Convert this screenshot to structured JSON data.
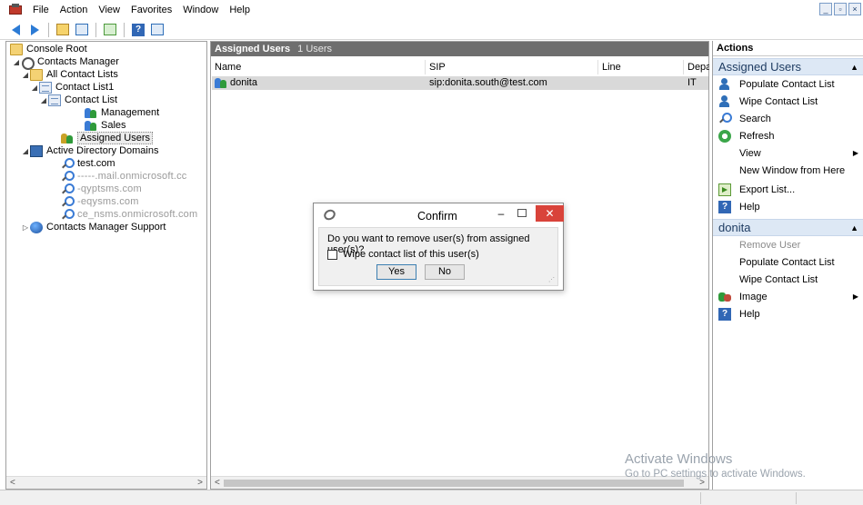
{
  "menubar": {
    "items": [
      "File",
      "Action",
      "View",
      "Favorites",
      "Window",
      "Help"
    ]
  },
  "tree": {
    "items": [
      {
        "label": "Console Root"
      },
      {
        "label": "Contacts Manager"
      },
      {
        "label": "All Contact Lists"
      },
      {
        "label": "Contact List1"
      },
      {
        "label": "Contact List"
      },
      {
        "label": "Management"
      },
      {
        "label": "Sales"
      },
      {
        "label": "Assigned Users"
      },
      {
        "label": "Active Directory Domains"
      },
      {
        "label": "test.com"
      },
      {
        "label": "-----.mail.onmicrosoft.cc"
      },
      {
        "label": "-qyptsms.com"
      },
      {
        "label": "-eqysms.com"
      },
      {
        "label": "ce_nsms.onmicrosoft.com"
      },
      {
        "label": "Contacts Manager Support"
      }
    ]
  },
  "center": {
    "header_title": "Assigned Users",
    "header_count": "1 Users",
    "columns": [
      "Name",
      "SIP",
      "Line",
      "Depa"
    ],
    "rows": [
      {
        "name": "donita",
        "sip": "sip:donita.south@test.com",
        "line": "",
        "dept": "IT"
      }
    ]
  },
  "actions": {
    "title": "Actions",
    "section1": {
      "label": "Assigned Users",
      "items": [
        "Populate Contact List",
        "Wipe Contact List",
        "Search",
        "Refresh",
        "View",
        "New Window from Here",
        "Export List...",
        "Help"
      ]
    },
    "section2": {
      "label": "donita",
      "items": [
        "Remove User",
        "Populate Contact List",
        "Wipe Contact List",
        "Image",
        "Help"
      ]
    }
  },
  "dialog": {
    "title": "Confirm",
    "question": "Do you want to remove user(s) from assigned user(s)?",
    "checkbox_label": "Wipe contact list of this user(s)",
    "checkbox_checked": false,
    "yes_label": "Yes",
    "no_label": "No",
    "close_symbol": "✕",
    "min_symbol": "–"
  },
  "watermark": {
    "line1": "Activate Windows",
    "line2": "Go to PC settings to activate Windows."
  },
  "scroll": {
    "left_arrow": "<",
    "right_arrow": ">"
  },
  "icons": {
    "menu_arrow": "▶",
    "collapse": "◢",
    "expand": "▷",
    "section_up": "▲"
  },
  "colors": {
    "center_header_bg": "#6e6e6e",
    "actions_section_bg": "#dde8f5",
    "selected_row_bg": "#d9d9d9",
    "close_button": "#d9433a"
  }
}
